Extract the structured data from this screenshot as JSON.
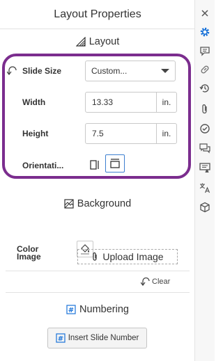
{
  "panel": {
    "title": "Layout Properties"
  },
  "layout_section": {
    "heading": "Layout",
    "slide_size": {
      "label": "Slide Size",
      "value": "Custom..."
    },
    "width": {
      "label": "Width",
      "value": "13.33",
      "unit": "in."
    },
    "height": {
      "label": "Height",
      "value": "7.5",
      "unit": "in."
    },
    "orientation": {
      "label": "Orientati...",
      "options": [
        "portrait",
        "landscape"
      ],
      "selected": "landscape"
    }
  },
  "background_section": {
    "heading": "Background",
    "color_label": "Color",
    "image_label": "Image",
    "upload_label": "Upload Image",
    "clear_label": "Clear"
  },
  "numbering_section": {
    "heading": "Numbering",
    "insert_label": "Insert Slide Number"
  },
  "sidebar": {
    "icons": [
      "close-icon",
      "gear-icon",
      "comment-icon",
      "link-icon",
      "history-icon",
      "attachment-icon",
      "check-circle-icon",
      "chat-icon",
      "presenter-icon",
      "translate-icon",
      "cube-icon"
    ],
    "active": "gear-icon"
  },
  "colors": {
    "accent": "#1a73d9",
    "highlight_ring": "#7b2d8e"
  }
}
